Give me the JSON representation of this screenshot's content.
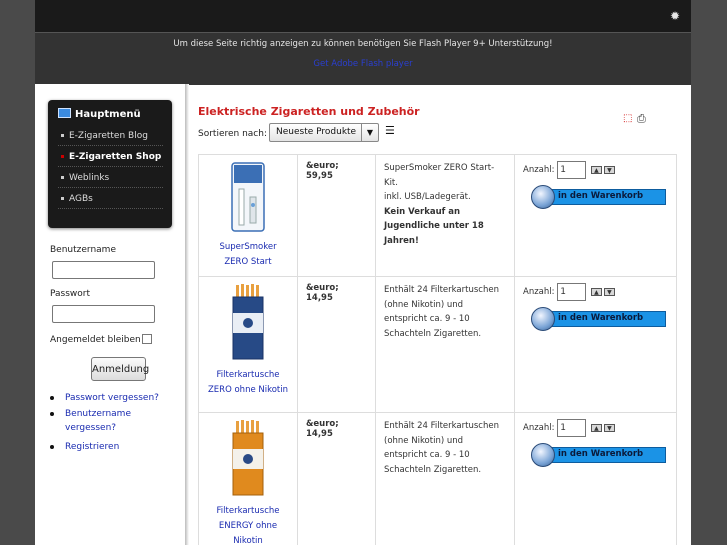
{
  "flash": {
    "message": "Um diese Seite richtig anzeigen zu können benötigen Sie Flash Player 9+ Unterstützung!",
    "link": "Get Adobe Flash player"
  },
  "menu": {
    "title": "Hauptmenü",
    "items": [
      {
        "label": "E-Zigaretten Blog"
      },
      {
        "label": "E-Zigaretten Shop",
        "active": true
      },
      {
        "label": "Weblinks"
      },
      {
        "label": "AGBs"
      }
    ]
  },
  "login": {
    "username_label": "Benutzername",
    "password_label": "Passwort",
    "remember_label": "Angemeldet bleiben",
    "button": "Anmeldung",
    "links": [
      "Passwort vergessen?",
      "Benutzername vergessen?",
      "Registrieren"
    ]
  },
  "main": {
    "title": "Elektrische Zigaretten und Zubehör",
    "sort_label": "Sortieren nach:",
    "sort_value": "Neueste Produkte",
    "sort_arrow": "▼",
    "sort_dir_glyph": "☰"
  },
  "cart": {
    "qty_label": "Anzahl:",
    "qty_default": "1",
    "button": "in den Warenkorb"
  },
  "products": [
    {
      "name": "SuperSmoker ZERO Start",
      "price": "&euro; 59,95",
      "description": "SuperSmoker ZERO Start-Kit.",
      "description2": "inkl. USB/Ladegerät.",
      "notice": "Kein Verkauf an Jugendliche unter 18 Jahren!",
      "pack_color": "#3b6fb5"
    },
    {
      "name": "Filterkartusche ZERO ohne Nikotin",
      "price": "&euro; 14,95",
      "description": "Enthält 24 Filterkartuschen (ohne Nikotin) und entspricht ca. 9 - 10 Schachteln Zigaretten.",
      "description2": "",
      "notice": "",
      "pack_color": "#274a86"
    },
    {
      "name": "Filterkartusche ENERGY ohne Nikotin",
      "price": "&euro; 14,95",
      "description": "Enthält 24 Filterkartuschen (ohne Nikotin) und entspricht ca. 9 - 10 Schachteln Zigaretten.",
      "description2": "",
      "notice": "",
      "pack_color": "#e08a1e"
    }
  ],
  "icons": {
    "gear": "gear-icon",
    "pdf": "pdf-icon",
    "print": "print-icon",
    "monitor": "monitor-icon"
  }
}
